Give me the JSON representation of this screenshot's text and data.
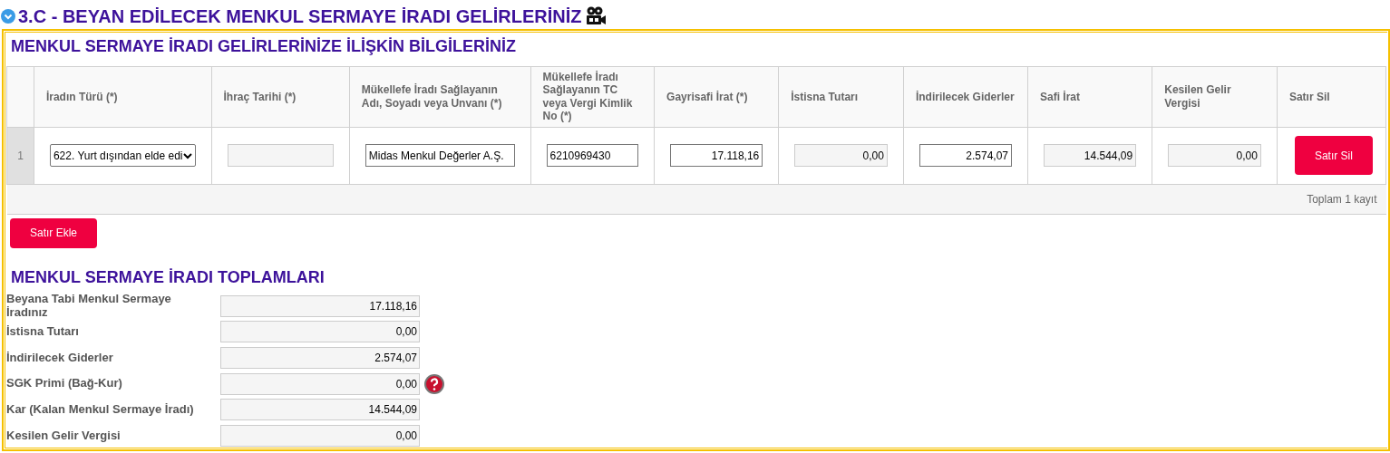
{
  "section_title": "3.C - BEYAN EDİLECEK MENKUL SERMAYE İRADI GELİRLERİNİZ",
  "panel_title": "MENKUL SERMAYE İRADI GELİRLERİNİZE İLİŞKİN BİLGİLERİNİZ",
  "table": {
    "columns": [
      "İradın Türü (*)",
      "İhraç Tarihi (*)",
      "Mükellefe İradı Sağlayanın Adı, Soyadı veya Unvanı (*)",
      "Mükellefe İradı Sağlayanın TC veya Vergi Kimlik No (*)",
      "Gayrisafi İrat (*)",
      "İstisna Tutarı",
      "İndirilecek Giderler",
      "Safi İrat",
      "Kesilen Gelir Vergisi",
      "Satır Sil"
    ],
    "rows": [
      {
        "number": "1",
        "cells": [
          {
            "kind": "select",
            "value": "622. Yurt dışından elde edi"
          },
          {
            "kind": "readonly"
          },
          {
            "kind": "text",
            "value": "Midas Menkul Değerler A.Ş."
          },
          {
            "kind": "text",
            "value": "6210969430"
          },
          {
            "kind": "amount",
            "value": "17.118,16"
          },
          {
            "kind": "readonly",
            "value": "0,00"
          },
          {
            "kind": "amount",
            "value": "2.574,07"
          },
          {
            "kind": "readonly",
            "value": "14.544,09"
          },
          {
            "kind": "readonly",
            "value": "0,00"
          },
          {
            "kind": "button",
            "value": "Satır Sil"
          }
        ]
      }
    ],
    "footer": "Toplam 1 kayıt"
  },
  "add_button": "Satır Ekle",
  "totals_title": "MENKUL SERMAYE İRADI TOPLAMLARI",
  "totals": [
    {
      "label": "Beyana Tabi Menkul Sermaye İradınız",
      "value": "17.118,16",
      "help": false
    },
    {
      "label": "İstisna Tutarı",
      "value": "0,00",
      "help": false
    },
    {
      "label": "İndirilecek Giderler",
      "value": "2.574,07",
      "help": false
    },
    {
      "label": "SGK Primi (Bağ-Kur)",
      "value": "0,00",
      "help": true
    },
    {
      "label": "Kar (Kalan Menkul Sermaye İradı)",
      "value": "14.544,09",
      "help": false
    },
    {
      "label": "Kesilen Gelir Vergisi",
      "value": "0,00",
      "help": false
    }
  ]
}
